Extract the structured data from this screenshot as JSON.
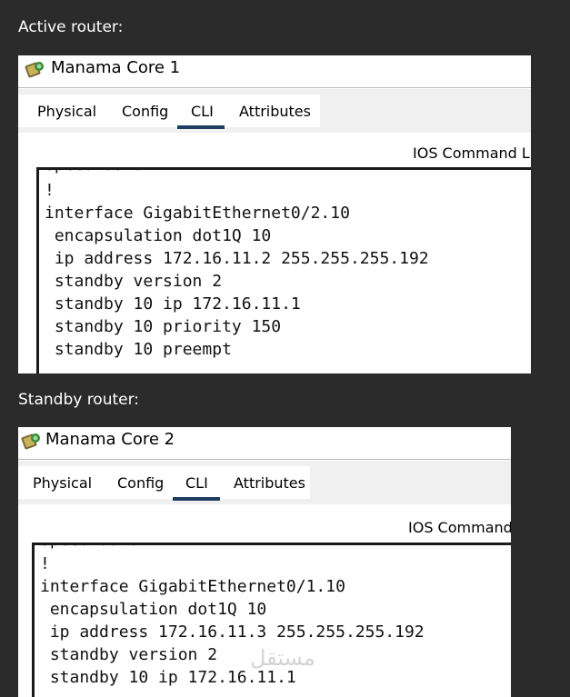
{
  "labels": {
    "active": "Active router:",
    "standby": "Standby router:"
  },
  "windows": [
    {
      "title": "Manama Core 1",
      "tabs": [
        "Physical",
        "Config",
        "CLI",
        "Attributes"
      ],
      "active_tab": "CLI",
      "ios_label": "IOS Command Lin",
      "lines": [
        "!",
        "interface GigabitEthernet0/2.10",
        " encapsulation dot1Q 10",
        " ip address 172.16.11.2 255.255.255.192",
        " standby version 2",
        " standby 10 ip 172.16.11.1",
        " standby 10 priority 150",
        " standby 10 preempt"
      ]
    },
    {
      "title": "Manama Core 2",
      "tabs": [
        "Physical",
        "Config",
        "CLI",
        "Attributes"
      ],
      "active_tab": "CLI",
      "ios_label": "IOS Command",
      "lines": [
        "!",
        "interface GigabitEthernet0/1.10",
        " encapsulation dot1Q 10",
        " ip address 172.16.11.3 255.255.255.192",
        " standby version 2",
        " standby 10 ip 172.16.11.1"
      ]
    }
  ],
  "watermark": "مستقل",
  "colors": {
    "background": "#2b2b2b",
    "tab_underline": "#1f3d63",
    "console_border": "#1a1a1a"
  }
}
